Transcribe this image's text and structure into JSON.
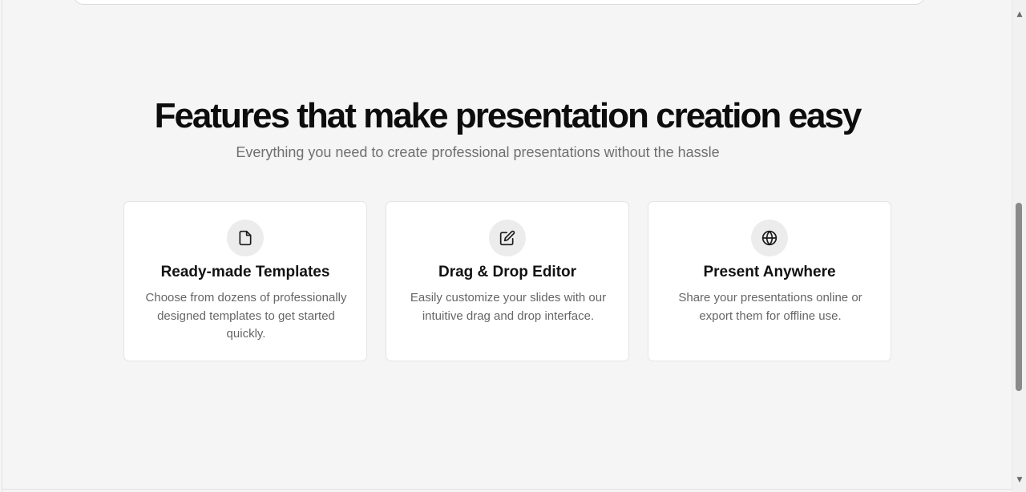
{
  "features": {
    "title": "Features that make presentation creation easy",
    "subtitle": "Everything you need to create professional presentations without the hassle",
    "cards": [
      {
        "icon": "file-icon",
        "title": "Ready-made Templates",
        "description": "Choose from dozens of professionally designed templates to get started quickly."
      },
      {
        "icon": "edit-icon",
        "title": "Drag & Drop Editor",
        "description": "Easily customize your slides with our intuitive drag and drop interface."
      },
      {
        "icon": "globe-icon",
        "title": "Present Anywhere",
        "description": "Share your presentations online or export them for offline use."
      }
    ]
  },
  "colors": {
    "page_background": "#f5f5f5",
    "card_background": "#ffffff",
    "icon_circle": "#ececec",
    "title_text": "#0d0d0d",
    "muted_text": "#6f6f6f"
  },
  "scrollbar": {
    "up_arrow": "▲",
    "down_arrow": "▼"
  }
}
